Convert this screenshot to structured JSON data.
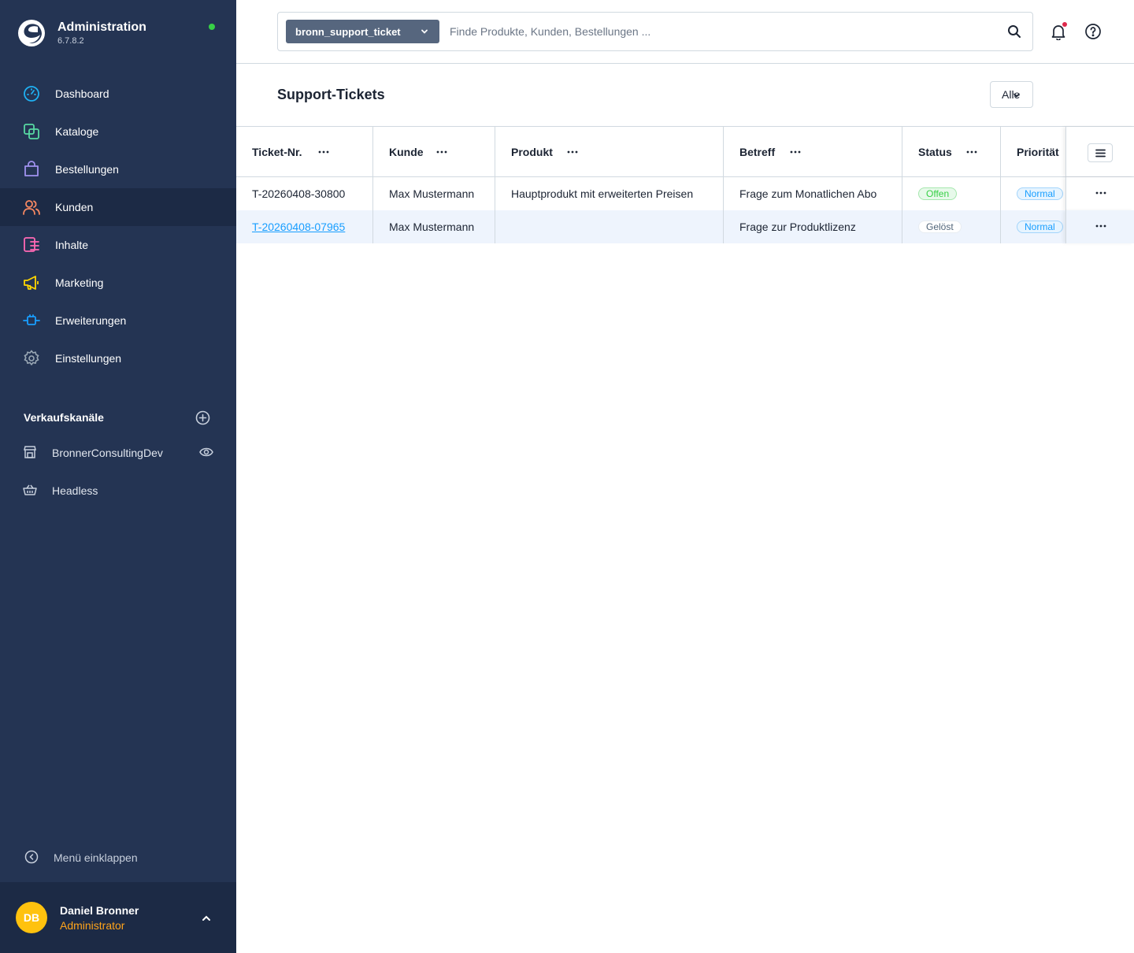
{
  "brand": {
    "title": "Administration",
    "version": "6.7.8.2"
  },
  "nav": [
    {
      "label": "Dashboard",
      "icon": "dashboard-icon",
      "color": "#1fb1f3"
    },
    {
      "label": "Kataloge",
      "icon": "catalog-icon",
      "color": "#57d9a3"
    },
    {
      "label": "Bestellungen",
      "icon": "orders-icon",
      "color": "#a092f0"
    },
    {
      "label": "Kunden",
      "icon": "customers-icon",
      "color": "#f88962",
      "active": true
    },
    {
      "label": "Inhalte",
      "icon": "content-icon",
      "color": "#ff68b4"
    },
    {
      "label": "Marketing",
      "icon": "marketing-icon",
      "color": "#ffd700"
    },
    {
      "label": "Erweiterungen",
      "icon": "extensions-icon",
      "color": "#189eff"
    },
    {
      "label": "Einstellungen",
      "icon": "settings-icon",
      "color": "#9aa8b5"
    }
  ],
  "sales_channels": {
    "title": "Verkaufskanäle",
    "items": [
      {
        "label": "BronnerConsultingDev",
        "icon": "storefront-icon"
      },
      {
        "label": "Headless",
        "icon": "basket-icon"
      }
    ]
  },
  "collapse_label": "Menü einklappen",
  "user": {
    "initials": "DB",
    "name": "Daniel Bronner",
    "role": "Administrator"
  },
  "search": {
    "type_label": "bronn_support_ticket",
    "placeholder": "Finde Produkte, Kunden, Bestellungen ..."
  },
  "page": {
    "title": "Support-Tickets",
    "filter_label": "Alle"
  },
  "table": {
    "columns": [
      "Ticket-Nr.",
      "Kunde",
      "Produkt",
      "Betreff",
      "Status",
      "Priorität"
    ],
    "rows": [
      {
        "ticket": "T-20260408-30800",
        "customer": "Max Mustermann",
        "product": "Hauptprodukt mit erweiterten Preisen",
        "subject": "Frage zum Monatlichen Abo",
        "status": "Offen",
        "priority": "Normal"
      },
      {
        "ticket": "T-20260408-07965",
        "customer": "Max Mustermann",
        "product": "",
        "subject": "Frage zur Produktlizenz",
        "status": "Gelöst",
        "priority": "Normal"
      }
    ]
  }
}
